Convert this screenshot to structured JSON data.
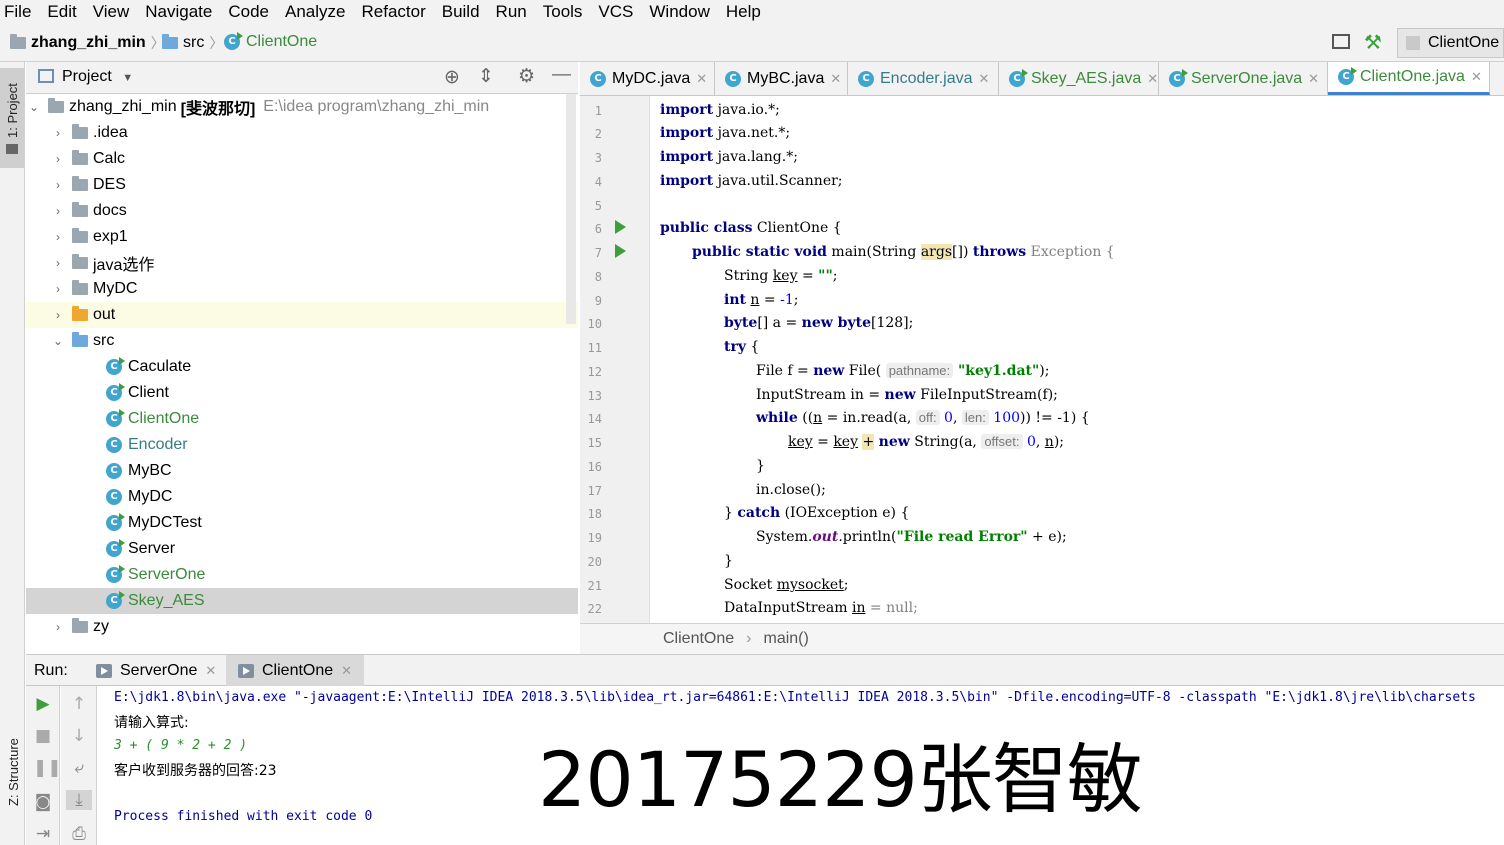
{
  "menu": [
    "File",
    "Edit",
    "View",
    "Navigate",
    "Code",
    "Analyze",
    "Refactor",
    "Build",
    "Run",
    "Tools",
    "VCS",
    "Window",
    "Help"
  ],
  "breadcrumb": {
    "project": "zhang_zhi_min",
    "folder": "src",
    "file": "ClientOne"
  },
  "run_config": "ClientOne",
  "left_stripe": {
    "project": "1: Project",
    "structure": "Z: Structure"
  },
  "project_panel": {
    "title": "Project",
    "root": {
      "name": "zhang_zhi_min",
      "tag": "[斐波那切]",
      "path": "E:\\idea program\\zhang_zhi_min"
    },
    "folders": [
      ".idea",
      "Calc",
      "DES",
      "docs",
      "exp1",
      "java选作",
      "MyDC",
      "out"
    ],
    "src_label": "src",
    "src_files": [
      "Caculate",
      "Client",
      "ClientOne",
      "Encoder",
      "MyBC",
      "MyDC",
      "MyDCTest",
      "Server",
      "ServerOne",
      "Skey_AES"
    ],
    "after": [
      "zy"
    ]
  },
  "editor_tabs": [
    "MyDC.java",
    "MyBC.java",
    "Encoder.java",
    "Skey_AES.java",
    "ServerOne.java",
    "ClientOne.java"
  ],
  "active_tab": "ClientOne.java",
  "line_numbers": [
    "1",
    "2",
    "3",
    "4",
    "5",
    "6",
    "7",
    "8",
    "9",
    "10",
    "11",
    "12",
    "13",
    "14",
    "15",
    "16",
    "17",
    "18",
    "19",
    "20",
    "21",
    "22"
  ],
  "code": {
    "l1": "java.io.*;",
    "l2": "java.net.*;",
    "l3": "java.lang.*;",
    "l4": "java.util.Scanner;",
    "kw_import": "import",
    "l6_kw": "public class",
    "l6_rest": " ClientOne {",
    "l7_kw": "public static void",
    "l7_a": " main(String ",
    "l7_args": "args",
    "l7_b": "[]) ",
    "l7_throws": "throws",
    "l7_c": " Exception {",
    "l8_a": "String ",
    "l8_var": "key",
    "l8_b": " = ",
    "l8_str": "\"\"",
    "l8_c": ";",
    "l9_kw": "int",
    "l9_a": " ",
    "l9_var": "n",
    "l9_b": " = ",
    "l9_num": "-1",
    "l9_c": ";",
    "l10_kw": "byte",
    "l10_a": "[] a = ",
    "l10_new": "new",
    "l10_kw2": " byte",
    "l10_b": "[128];",
    "l11_kw": "try",
    "l11_a": " {",
    "l12_a": "File f = ",
    "l12_new": "new",
    "l12_b": " File( ",
    "l12_hint": "pathname:",
    "l12_str": " \"key1.dat\"",
    "l12_c": ");",
    "l13_a": "InputStream in = ",
    "l13_new": "new",
    "l13_b": " FileInputStream(f);",
    "l14_kw": "while",
    "l14_a": " ((",
    "l14_var": "n",
    "l14_b": " = in.read(a, ",
    "l14_h1": "off:",
    "l14_n1": " 0",
    "l14_c": ", ",
    "l14_h2": "len:",
    "l14_n2": " 100",
    "l14_d": ")) != -1) {",
    "l15_var": "key",
    "l15_a": " = ",
    "l15_var2": "key",
    "l15_b": " ",
    "l15_plus": "+",
    "l15_c": " ",
    "l15_new": "new",
    "l15_d": " String(a, ",
    "l15_hint": "offset:",
    "l15_num": " 0",
    "l15_e": ", ",
    "l15_var3": "n",
    "l15_f": ");",
    "l16": "}",
    "l17": "in.close();",
    "l18_a": "} ",
    "l18_kw": "catch",
    "l18_b": " (IOException e) {",
    "l19_a": "System.",
    "l19_out": "out",
    "l19_b": ".println(",
    "l19_str": "\"File read Error\"",
    "l19_c": " + e);",
    "l20": "}",
    "l21_a": "Socket ",
    "l21_var": "mysocket",
    "l21_b": ";",
    "l22_a": "DataInputStream ",
    "l22_var": "in",
    "l22_b": " = null;"
  },
  "editor_breadcrumb": {
    "class": "ClientOne",
    "method": "main()"
  },
  "run_panel": {
    "label": "Run:",
    "tabs": [
      "ServerOne",
      "ClientOne"
    ],
    "console": [
      "E:\\jdk1.8\\bin\\java.exe \"-javaagent:E:\\IntelliJ IDEA 2018.3.5\\lib\\idea_rt.jar=64861:E:\\IntelliJ IDEA 2018.3.5\\bin\" -Dfile.encoding=UTF-8 -classpath \"E:\\jdk1.8\\jre\\lib\\charsets",
      "请输入算式:",
      "3 + ( 9 * 2 + 2 )",
      "客户收到服务器的回答:23",
      "",
      "Process finished with exit code 0"
    ]
  },
  "watermark": "20175229张智敏"
}
